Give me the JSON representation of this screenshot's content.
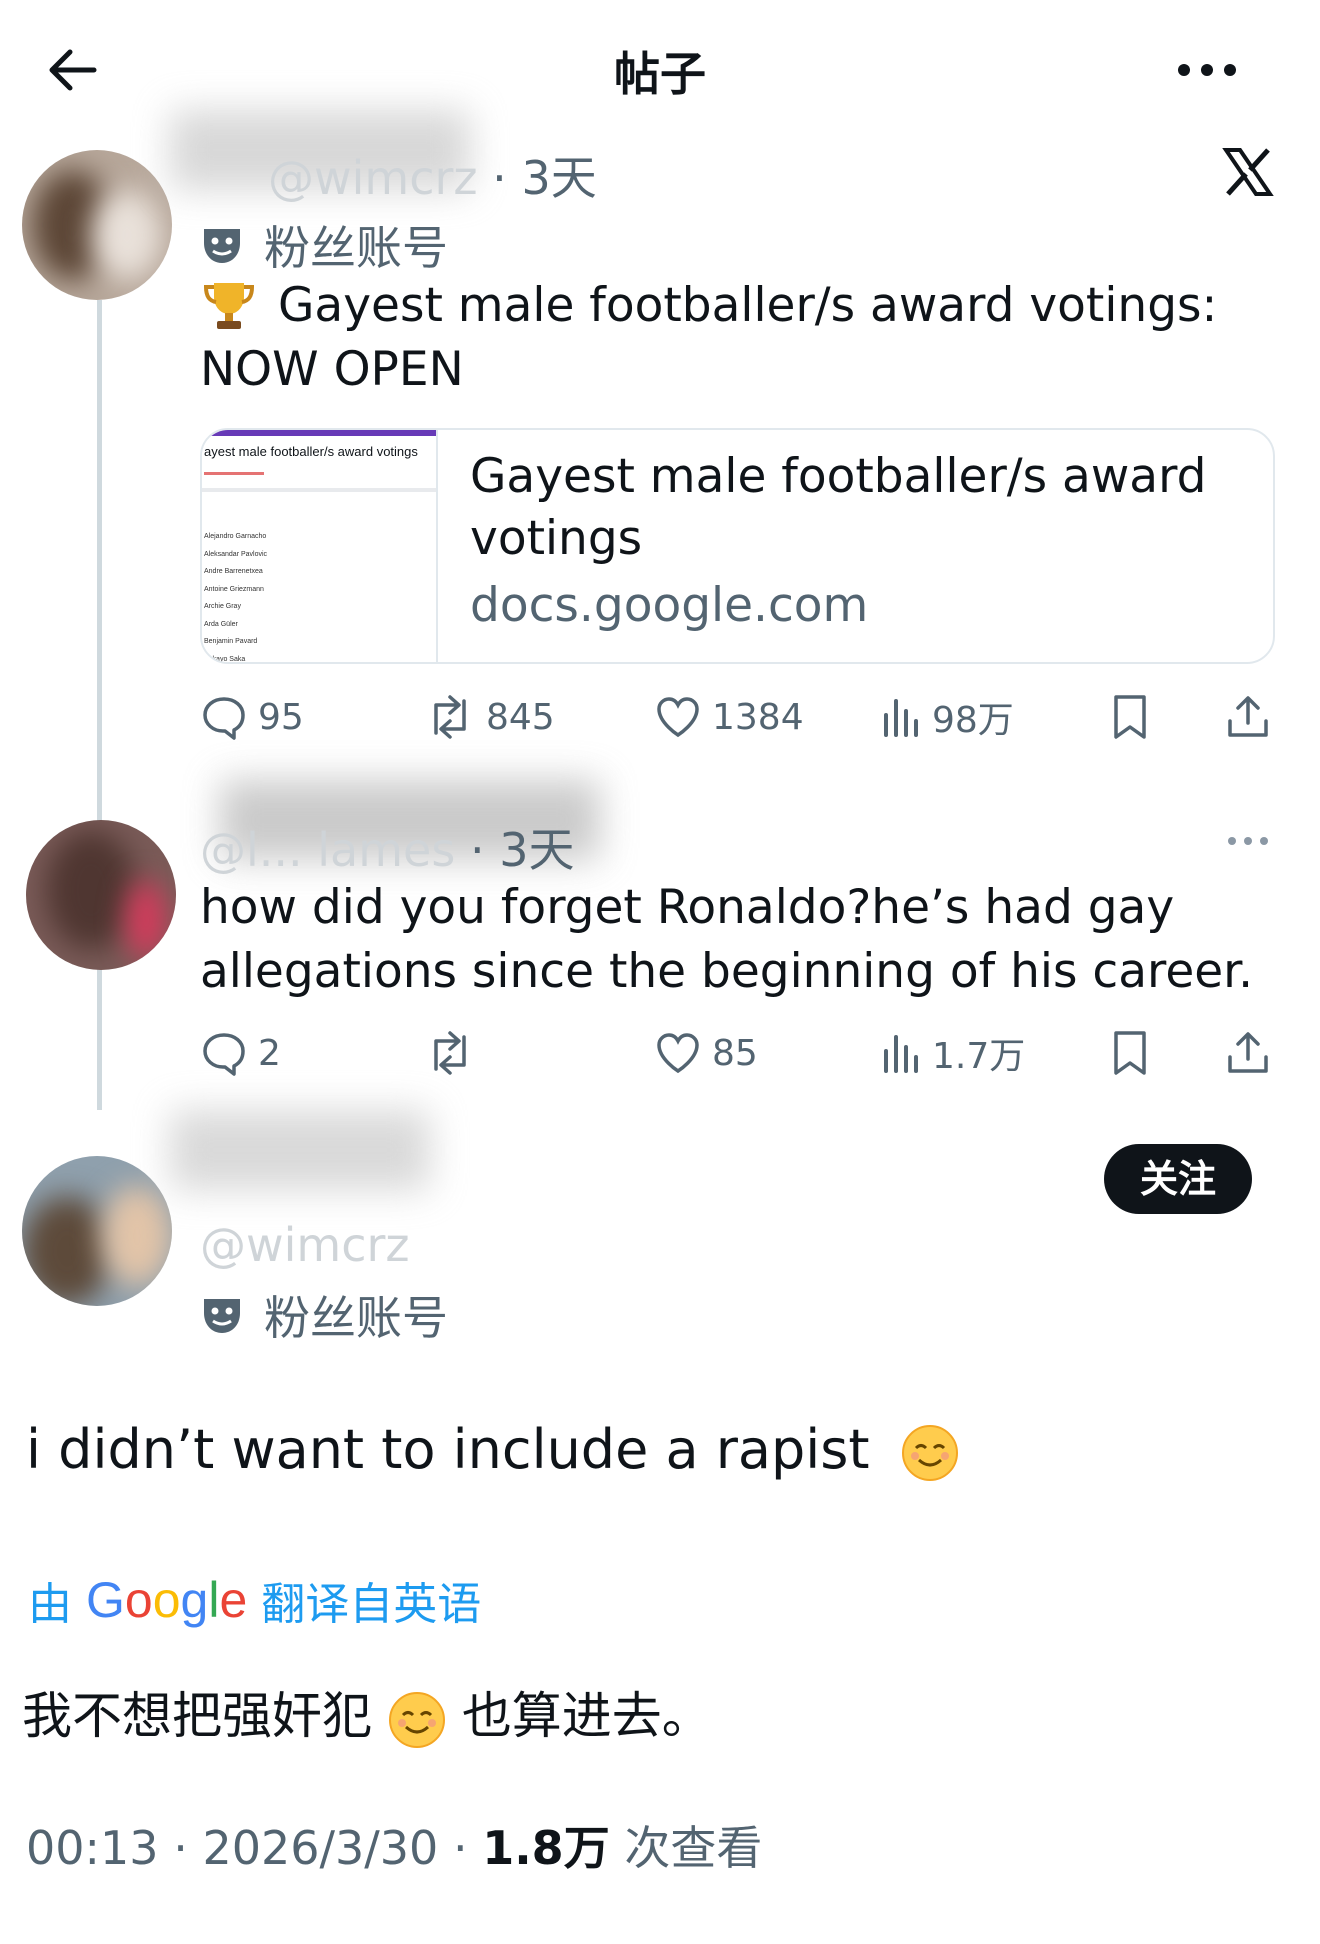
{
  "header": {
    "title": "帖子"
  },
  "original_post": {
    "handle": "@wimcrz",
    "time_sep": " · ",
    "time": "3天",
    "fan_label": "粉丝账号",
    "text_line1": "Gayest male footballer/s award votings:",
    "text_line2": "NOW OPEN",
    "card": {
      "thumb_title": "ayest male footballer/s award votings",
      "thumb_names": [
        "Alejandro Garnacho",
        "Aleksandar Pavlovic",
        "Andre Barrenetxea",
        "Antoine Griezmann",
        "Archie Gray",
        "Arda Güler",
        "Benjamin Pavard",
        "Bukayo Saka"
      ],
      "title_line1": "Gayest male footballer/s award",
      "title_line2": "votings",
      "domain": "docs.google.com"
    },
    "stats": {
      "replies": "95",
      "reposts": "845",
      "likes": "1384",
      "views": "98万"
    }
  },
  "reply_post": {
    "handle": "@l... lames",
    "time_sep": " · ",
    "time": "3天",
    "text_line1": "how did you forget Ronaldo?he’s had gay",
    "text_line2": "allegations since the beginning of his career.",
    "stats": {
      "replies": "2",
      "reposts": "",
      "likes": "85",
      "views": "1.7万"
    }
  },
  "main_post": {
    "follow_label": "关注",
    "handle": "@wimcrz",
    "fan_label": "粉丝账号",
    "text": "i didn’t want to include a rapist",
    "translate_prefix": "由",
    "translate_brand": "Google",
    "translate_suffix": "翻译自英语",
    "translated_part1": "我不想把强奸犯",
    "translated_part2": "也算进去。",
    "time": "00:13",
    "date": "2026/3/30",
    "views": "1.8万",
    "views_label": "次查看"
  },
  "colors": {
    "accent": "#1d9bf0",
    "text": "#0f1419",
    "muted": "#536471",
    "thread": "#cfd9de"
  }
}
